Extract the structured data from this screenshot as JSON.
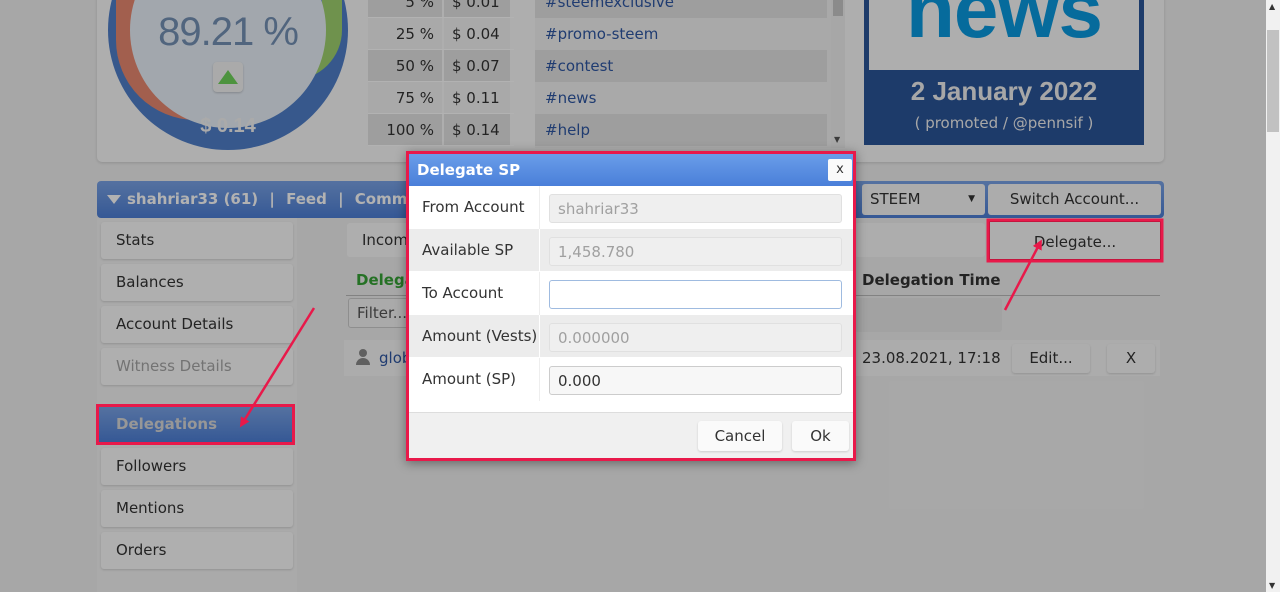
{
  "gauge": {
    "percent_label": "89.21 %",
    "vote_value": "$ 0.14",
    "trend_icon": "up-triangle-icon"
  },
  "vote_table": [
    {
      "percent": "5 %",
      "value": "$ 0.01"
    },
    {
      "percent": "25 %",
      "value": "$ 0.04"
    },
    {
      "percent": "50 %",
      "value": "$ 0.07"
    },
    {
      "percent": "75 %",
      "value": "$ 0.11"
    },
    {
      "percent": "100 %",
      "value": "$ 0.14"
    }
  ],
  "tags": [
    "#steemexclusive",
    "#promo-steem",
    "#contest",
    "#news",
    "#help"
  ],
  "news_banner": {
    "word": "news",
    "date": "2 January 2022",
    "promo": "( promoted / @pennsif )"
  },
  "account_bar": {
    "account": "shahriar33 (61)",
    "separator": "|",
    "feed": "Feed",
    "communities": "Communities",
    "currency": "STEEM",
    "switch_account": "Switch Account..."
  },
  "sidebar": {
    "items": [
      {
        "label": "Stats",
        "state": "normal"
      },
      {
        "label": "Balances",
        "state": "normal"
      },
      {
        "label": "Account Details",
        "state": "normal"
      },
      {
        "label": "Witness Details",
        "state": "disabled"
      },
      {
        "label": "Delegations",
        "state": "active"
      },
      {
        "label": "Followers",
        "state": "normal"
      },
      {
        "label": "Mentions",
        "state": "normal"
      },
      {
        "label": "Orders",
        "state": "normal"
      }
    ]
  },
  "main": {
    "tab_incoming": "Incom",
    "delegate_button": "Delegate...",
    "table_headers": {
      "delegatee": "Delega",
      "delegation_time": "Delegation Time"
    },
    "filter_placeholder": "Filter...",
    "rows": [
      {
        "name": "glob",
        "time": "23.08.2021, 17:18",
        "edit": "Edit...",
        "remove": "X"
      }
    ]
  },
  "modal": {
    "title": "Delegate SP",
    "close": "x",
    "fields": [
      {
        "label": "From Account",
        "value": "shahriar33",
        "state": "disabled"
      },
      {
        "label": "Available SP",
        "value": "1,458.780",
        "state": "disabled"
      },
      {
        "label": "To Account",
        "value": "",
        "state": "focused"
      },
      {
        "label": "Amount (Vests)",
        "value": "0.000000",
        "state": "disabled"
      },
      {
        "label": "Amount (SP)",
        "value": "0.000",
        "state": "editable"
      }
    ],
    "cancel": "Cancel",
    "ok": "Ok"
  },
  "colors": {
    "accent_blue": "#4d7fd6",
    "highlight_red": "#e8194a",
    "link_blue": "#2e57a3",
    "green_header": "#36a336"
  }
}
